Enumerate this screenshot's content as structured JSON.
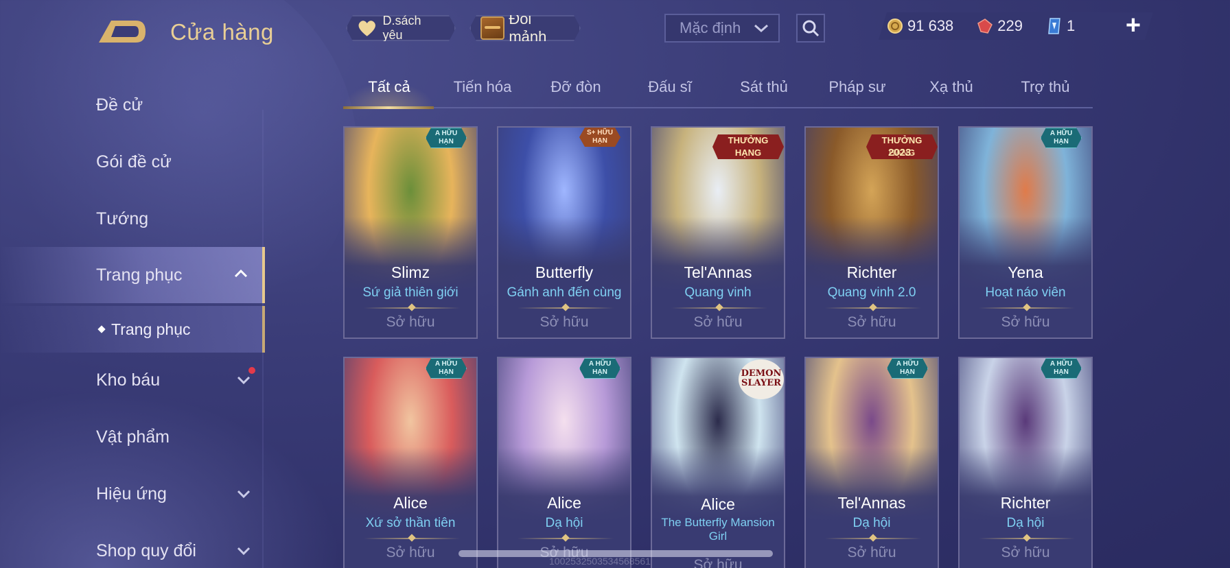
{
  "header": {
    "title": "Cửa hàng",
    "favorites_label": "D.sách yêu",
    "trade_label": "Đổi mảnh",
    "sort_value": "Mặc định"
  },
  "currency": {
    "gold": "91 638",
    "voucher": "229",
    "crystal": "1"
  },
  "sidebar": {
    "items": [
      {
        "label": "Đề cử"
      },
      {
        "label": "Gói đề cử"
      },
      {
        "label": "Tướng"
      },
      {
        "label": "Trang phục"
      },
      {
        "label": "Kho báu"
      },
      {
        "label": "Vật phẩm"
      },
      {
        "label": "Hiệu ứng"
      },
      {
        "label": "Shop quy đổi"
      }
    ],
    "sub_item": "Trang phục"
  },
  "tabs": [
    "Tất cả",
    "Tiến hóa",
    "Đỡ đòn",
    "Đấu sĩ",
    "Sát thủ",
    "Pháp sư",
    "Xạ thủ",
    "Trợ thủ"
  ],
  "cards": [
    {
      "name": "Slimz",
      "skin": "Sứ giả thiên giới",
      "status": "Sở hữu",
      "tag": "A HỮU HẠN",
      "colors": [
        "#e7b45c",
        "#6b8f3a"
      ]
    },
    {
      "name": "Butterfly",
      "skin": "Gánh anh đến cùng",
      "status": "Sở hữu",
      "tag": "S+ HỮU HẠN",
      "colors": [
        "#3d4fa8",
        "#9fb6ff"
      ]
    },
    {
      "name": "Tel'Annas",
      "skin": "Quang vinh",
      "status": "Sở hữu",
      "tag": "THƯỞNG HẠNG",
      "colors": [
        "#c7b27c",
        "#e9eef5"
      ]
    },
    {
      "name": "Richter",
      "skin": "Quang vinh 2.0",
      "status": "Sở hữu",
      "tag": "THƯỞNG HẠNG",
      "year": "2023",
      "colors": [
        "#8a5a2a",
        "#d4a457"
      ]
    },
    {
      "name": "Yena",
      "skin": "Hoạt náo viên",
      "status": "Sở hữu",
      "tag": "A HỮU HẠN",
      "colors": [
        "#7fb3d9",
        "#e07b4a"
      ]
    },
    {
      "name": "Alice",
      "skin": "Xứ sở thần tiên",
      "status": "Sở hữu",
      "tag": "A HỮU HẠN",
      "colors": [
        "#d95c5c",
        "#f1c5a0"
      ]
    },
    {
      "name": "Alice",
      "skin": "Dạ hội",
      "status": "Sở hữu",
      "tag": "A HỮU HẠN",
      "colors": [
        "#b79ad8",
        "#f4dfee"
      ]
    },
    {
      "name": "Alice",
      "skin": "The Butterfly Mansion Girl",
      "status": "Sở hữu",
      "tag": "DEMON SLAYER",
      "colors": [
        "#cfe4ef",
        "#2c2c4c"
      ]
    },
    {
      "name": "Tel'Annas",
      "skin": "Dạ hội",
      "status": "Sở hữu",
      "tag": "A HỮU HẠN",
      "colors": [
        "#e4c28c",
        "#7a4a8a"
      ]
    },
    {
      "name": "Richter",
      "skin": "Dạ hội",
      "status": "Sở hữu",
      "tag": "A HỮU HẠN",
      "colors": [
        "#c9d3e8",
        "#5a3a7a"
      ]
    }
  ],
  "watermark": "1002532503534568561",
  "colors": {
    "accent_gold": "#e9cf95",
    "skin_name_blue": "#7fd0f2",
    "background": "#3a3c77"
  }
}
